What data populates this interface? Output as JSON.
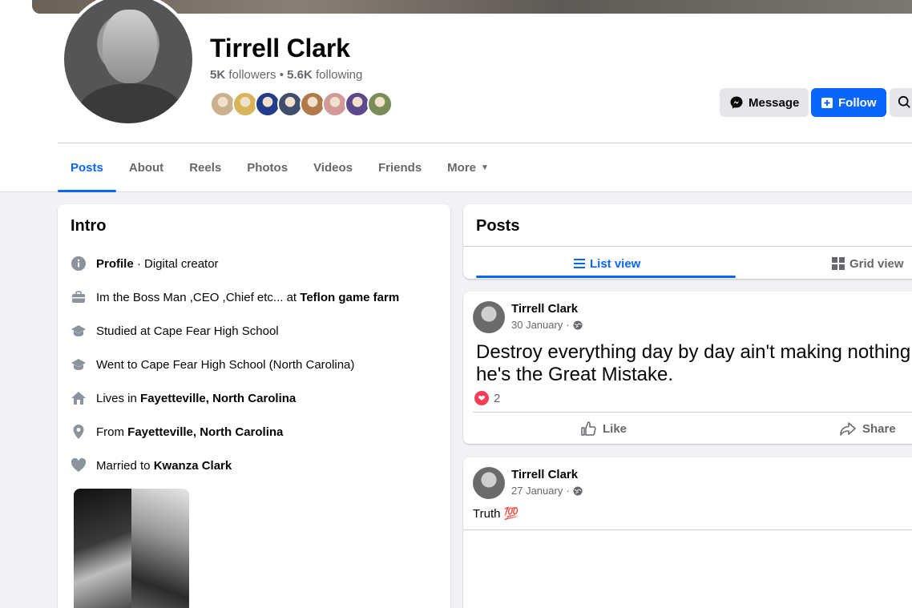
{
  "profile": {
    "name": "Tirrell Clark",
    "followers": "5K",
    "followers_label": "followers",
    "separator": " • ",
    "following": "5.6K",
    "following_label": "following",
    "friend_avatar_colors": [
      "#c9b18e",
      "#d8b45a",
      "#233c8c",
      "#3f4e6a",
      "#b07a4b",
      "#d39a9a",
      "#5d4a8a",
      "#7a8d58"
    ]
  },
  "actions": {
    "message_label": "Message",
    "follow_label": "Follow"
  },
  "tabs": [
    {
      "label": "Posts",
      "active": true
    },
    {
      "label": "About"
    },
    {
      "label": "Reels"
    },
    {
      "label": "Photos"
    },
    {
      "label": "Videos"
    },
    {
      "label": "Friends"
    },
    {
      "label": "More"
    }
  ],
  "intro": {
    "title": "Intro",
    "items": [
      {
        "icon": "info-icon",
        "bold_prefix": "Profile",
        "text": " · Digital creator"
      },
      {
        "icon": "briefcase-icon",
        "text": "Im the Boss Man ,CEO ,Chief etc... at ",
        "bold": "Teflon game farm"
      },
      {
        "icon": "graduation-cap-icon",
        "text": "Studied at Cape Fear High School"
      },
      {
        "icon": "graduation-cap-icon",
        "text": "Went to Cape Fear High School (North Carolina)"
      },
      {
        "icon": "home-icon",
        "text": "Lives in ",
        "bold": "Fayetteville, North Carolina"
      },
      {
        "icon": "location-pin-icon",
        "text": "From ",
        "bold": "Fayetteville, North Carolina"
      },
      {
        "icon": "heart-icon",
        "text": "Married to ",
        "bold": "Kwanza Clark"
      }
    ]
  },
  "posts_section": {
    "title": "Posts",
    "list_view": "List view",
    "grid_view": "Grid view"
  },
  "posts": [
    {
      "author": "Tirrell Clark",
      "date": "30 January",
      "dot": "·",
      "text_line1": "Destroy everything day by day ain't making nothing",
      "text_line2": "he's the Great Mistake.",
      "reaction_count": "2",
      "like_label": "Like",
      "share_label": "Share"
    },
    {
      "author": "Tirrell Clark",
      "date": "27 January",
      "dot": "·",
      "text": "Truth 💯"
    }
  ]
}
